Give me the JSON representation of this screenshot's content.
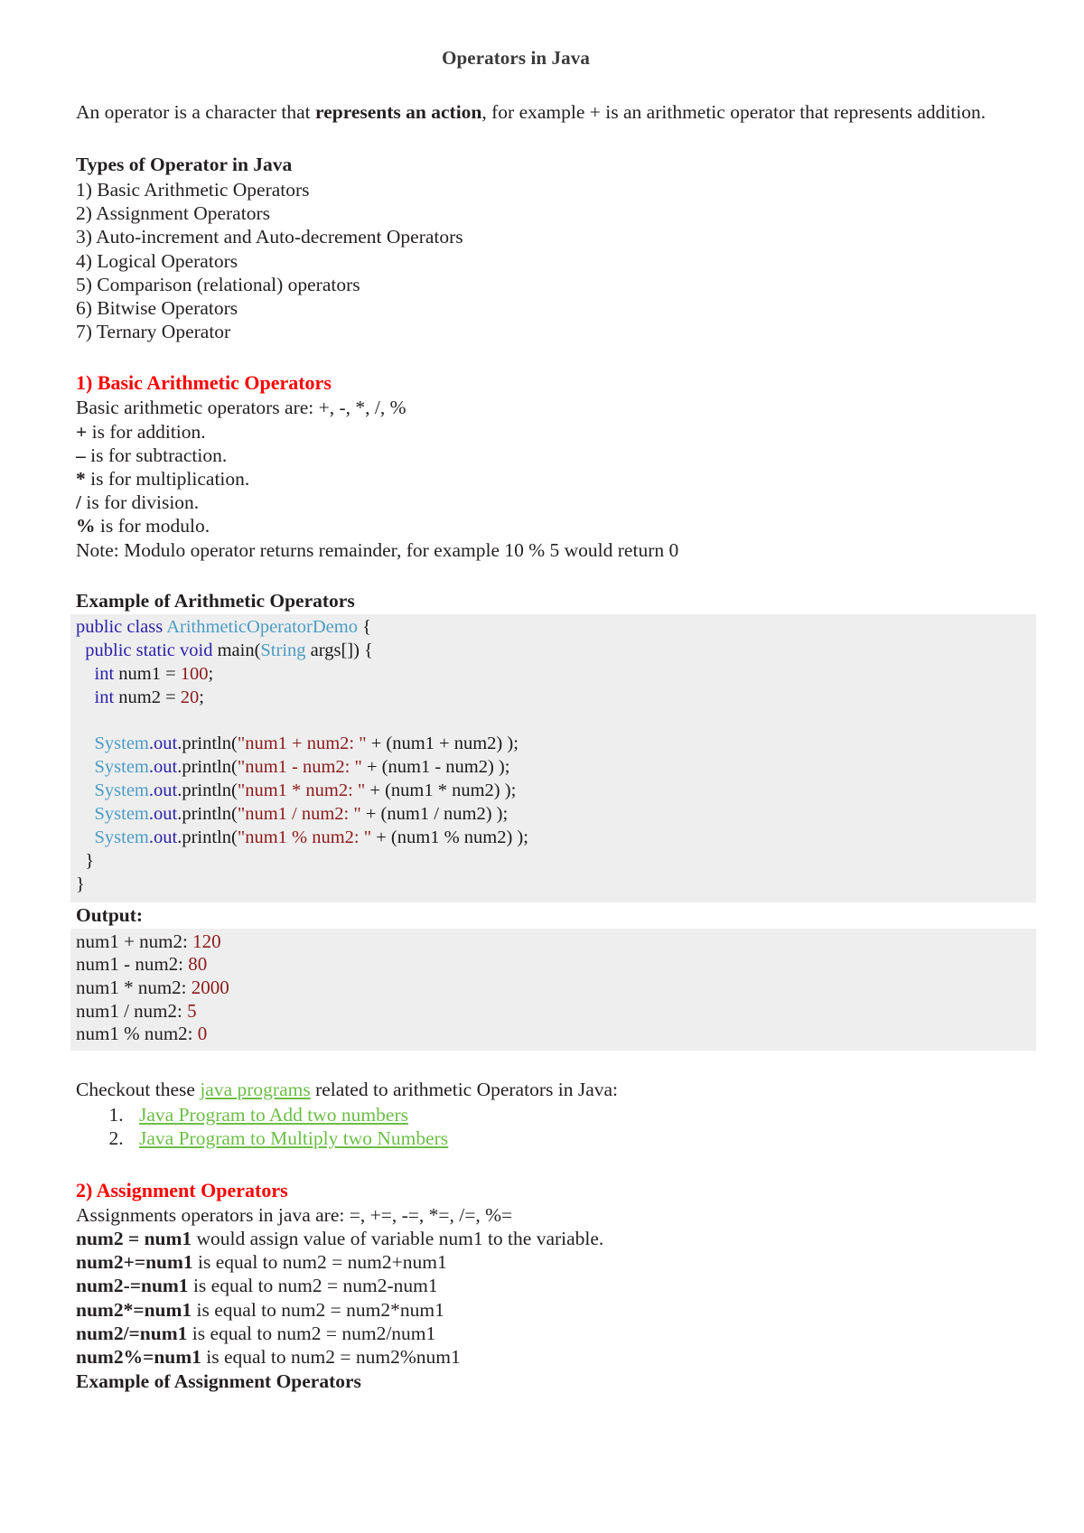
{
  "document": {
    "title": "Operators in Java",
    "intro": {
      "before": "An operator is a character that ",
      "bold": "represents an action",
      "after": ", for example + is an arithmetic operator that represents addition."
    },
    "types_section": {
      "heading": "Types of Operator in Java",
      "items": [
        "1) Basic Arithmetic Operators",
        "2) Assignment Operators",
        "3) Auto-increment and Auto-decrement Operators",
        "4) Logical Operators",
        "5) Comparison (relational) operators",
        "6) Bitwise Operators",
        "7) Ternary Operator"
      ]
    },
    "section_arithmetic": {
      "heading": "1) Basic Arithmetic Operators",
      "lead": "Basic arithmetic operators are: +, -, *, /, %",
      "operator_lines": [
        {
          "symbol": "+",
          "text": " is for addition."
        },
        {
          "symbol": "–",
          "text": " is for subtraction."
        },
        {
          "symbol": "*",
          "text": " is for multiplication."
        },
        {
          "symbol": "/",
          "text": " is for division."
        },
        {
          "symbol": "%",
          "text": " is for modulo."
        }
      ],
      "note": "Note: Modulo operator returns remainder, for example 10 % 5 would return 0",
      "example_heading": "Example of Arithmetic Operators",
      "code_lines": [
        [
          {
            "t": "public class ",
            "c": "kw"
          },
          {
            "t": "ArithmeticOperatorDemo",
            "c": "typ"
          },
          {
            "t": " {",
            "c": "plain"
          }
        ],
        [
          {
            "t": "  public static void ",
            "c": "kw"
          },
          {
            "t": "main(",
            "c": "plain"
          },
          {
            "t": "String",
            "c": "typ"
          },
          {
            "t": " args[]) {",
            "c": "plain"
          }
        ],
        [
          {
            "t": "    int",
            "c": "kw"
          },
          {
            "t": " num1 = ",
            "c": "plain"
          },
          {
            "t": "100",
            "c": "lit"
          },
          {
            "t": ";",
            "c": "plain"
          }
        ],
        [
          {
            "t": "    int",
            "c": "kw"
          },
          {
            "t": " num2 = ",
            "c": "plain"
          },
          {
            "t": "20",
            "c": "lit"
          },
          {
            "t": ";",
            "c": "plain"
          }
        ],
        [
          {
            "t": " ",
            "c": "plain"
          }
        ],
        [
          {
            "t": "    System",
            "c": "typ"
          },
          {
            "t": ".out",
            "c": "kw"
          },
          {
            "t": ".println(",
            "c": "plain"
          },
          {
            "t": "\"num1 + num2: \"",
            "c": "lit"
          },
          {
            "t": " + (num1 + num2) );",
            "c": "plain"
          }
        ],
        [
          {
            "t": "    System",
            "c": "typ"
          },
          {
            "t": ".out",
            "c": "kw"
          },
          {
            "t": ".println(",
            "c": "plain"
          },
          {
            "t": "\"num1 - num2: \"",
            "c": "lit"
          },
          {
            "t": " + (num1 - num2) );",
            "c": "plain"
          }
        ],
        [
          {
            "t": "    System",
            "c": "typ"
          },
          {
            "t": ".out",
            "c": "kw"
          },
          {
            "t": ".println(",
            "c": "plain"
          },
          {
            "t": "\"num1 * num2: \"",
            "c": "lit"
          },
          {
            "t": " + (num1 * num2) );",
            "c": "plain"
          }
        ],
        [
          {
            "t": "    System",
            "c": "typ"
          },
          {
            "t": ".out",
            "c": "kw"
          },
          {
            "t": ".println(",
            "c": "plain"
          },
          {
            "t": "\"num1 / num2: \"",
            "c": "lit"
          },
          {
            "t": " + (num1 / num2) );",
            "c": "plain"
          }
        ],
        [
          {
            "t": "    System",
            "c": "typ"
          },
          {
            "t": ".out",
            "c": "kw"
          },
          {
            "t": ".println(",
            "c": "plain"
          },
          {
            "t": "\"num1 % num2: \"",
            "c": "lit"
          },
          {
            "t": " + (num1 % num2) );",
            "c": "plain"
          }
        ],
        [
          {
            "t": "  }",
            "c": "plain"
          }
        ],
        [
          {
            "t": "}",
            "c": "plain"
          }
        ]
      ],
      "output_label": "Output:",
      "output_lines": [
        {
          "label": "num1 + num2: ",
          "value": "120"
        },
        {
          "label": "num1 - num2: ",
          "value": "80"
        },
        {
          "label": "num1 * num2: ",
          "value": "2000"
        },
        {
          "label": "num1 / num2: ",
          "value": "5"
        },
        {
          "label": "num1 % num2: ",
          "value": "0"
        }
      ],
      "checkout": {
        "before": "Checkout these ",
        "link": "java programs",
        "after": " related to arithmetic Operators in Java:"
      },
      "program_links": [
        "Java Program to Add two numbers",
        "Java Program to Multiply two Numbers"
      ]
    },
    "section_assignment": {
      "heading": "2) Assignment Operators",
      "lead": "Assignments operators in java are: =, +=, -=, *=, /=, %=",
      "lines": [
        {
          "bold": "num2 = num1",
          "rest": " would assign value of variable num1 to the variable."
        },
        {
          "bold": "num2+=num1",
          "rest": " is equal to num2 = num2+num1"
        },
        {
          "bold": "num2-=num1",
          "rest": " is equal to num2 = num2-num1"
        },
        {
          "bold": "num2*=num1",
          "rest": " is equal to num2 = num2*num1"
        },
        {
          "bold": "num2/=num1",
          "rest": " is equal to num2 = num2/num1"
        },
        {
          "bold": "num2%=num1",
          "rest": " is equal to num2 = num2%num1"
        }
      ],
      "example_heading": "Example of Assignment Operators"
    }
  },
  "colors": {
    "heading_red": "#ff0000",
    "link_green": "#6cbe45",
    "code_bg": "#eeeeee",
    "code_keyword": "#2b22a8",
    "code_type": "#4b9cc4",
    "code_literal": "#8c1a1a",
    "text": "#231f20"
  }
}
